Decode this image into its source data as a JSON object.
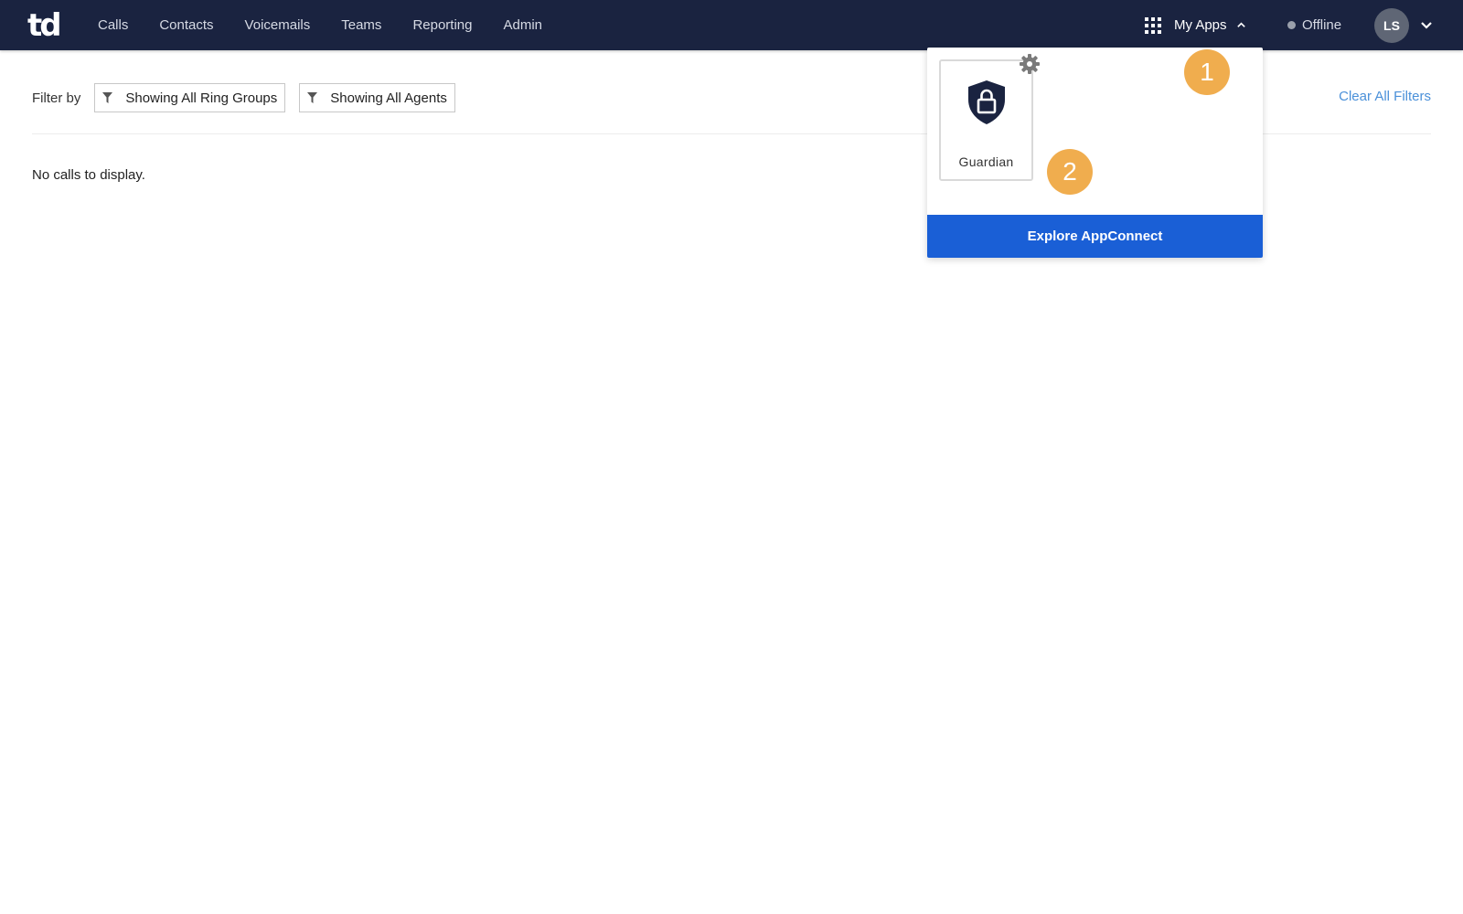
{
  "header": {
    "logo_text": "td",
    "nav": [
      "Calls",
      "Contacts",
      "Voicemails",
      "Teams",
      "Reporting",
      "Admin"
    ],
    "my_apps_label": "My Apps",
    "status_label": "Offline",
    "avatar_initials": "LS"
  },
  "filters": {
    "label": "Filter by",
    "ring_groups": "Showing All Ring Groups",
    "agents": "Showing All Agents",
    "clear_all": "Clear All Filters"
  },
  "main": {
    "empty_message": "No calls to display."
  },
  "apps_dropdown": {
    "apps": [
      {
        "name": "Guardian",
        "icon": "shield-lock-icon"
      }
    ],
    "explore_label": "Explore AppConnect"
  },
  "callouts": [
    "1",
    "2"
  ],
  "colors": {
    "topbar": "#1a2340",
    "accent_blue": "#1a5fd6",
    "link_blue": "#4a90d9",
    "callout_orange": "#f0ad4e"
  }
}
